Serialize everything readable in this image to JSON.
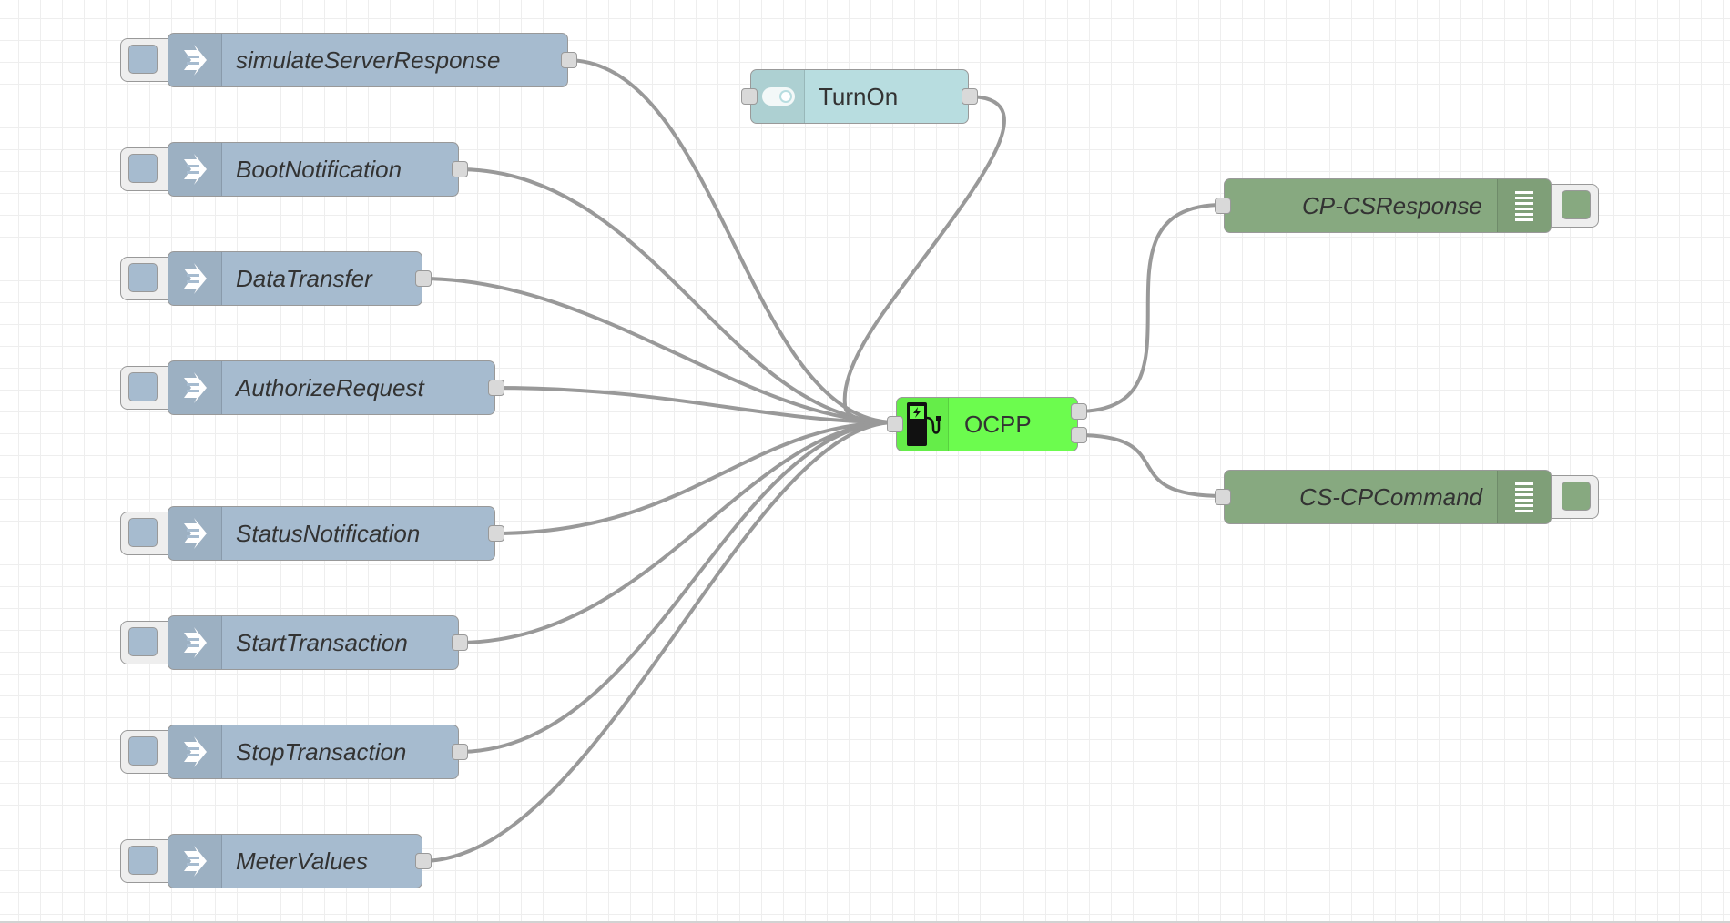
{
  "app": "Node-RED flow editor",
  "canvas": {
    "grid": true,
    "background": "#ffffff",
    "wire_color": "#999999"
  },
  "inject_nodes": [
    {
      "label": "simulateServerResponse",
      "icon": "inject-arrow-icon"
    },
    {
      "label": "BootNotification",
      "icon": "inject-arrow-icon"
    },
    {
      "label": "DataTransfer",
      "icon": "inject-arrow-icon"
    },
    {
      "label": "AuthorizeRequest",
      "icon": "inject-arrow-icon"
    },
    {
      "label": "StatusNotification",
      "icon": "inject-arrow-icon"
    },
    {
      "label": "StartTransaction",
      "icon": "inject-arrow-icon"
    },
    {
      "label": "StopTransaction",
      "icon": "inject-arrow-icon"
    },
    {
      "label": "MeterValues",
      "icon": "inject-arrow-icon"
    }
  ],
  "toggle_node": {
    "label": "TurnOn",
    "icon": "toggle-switch-icon",
    "color": "#b8dde0"
  },
  "ocpp_node": {
    "label": "OCPP",
    "icon": "charging-station-icon",
    "color": "#6cfc4e"
  },
  "debug_nodes": [
    {
      "label": "CP-CSResponse",
      "icon": "debug-list-icon"
    },
    {
      "label": "CS-CPCommand",
      "icon": "debug-list-icon"
    }
  ],
  "colors": {
    "inject": "#a6bbcf",
    "debug": "#87a980"
  }
}
